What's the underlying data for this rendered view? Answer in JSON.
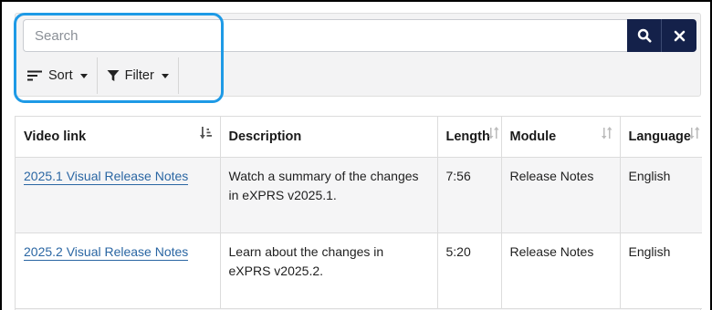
{
  "toolbar": {
    "search_placeholder": "Search",
    "search_value": "",
    "sort_label": "Sort",
    "filter_label": "Filter",
    "search_icon": "search-icon",
    "clear_icon": "close-icon",
    "highlight_color": "#1e9ae6",
    "button_color": "#14214a"
  },
  "table": {
    "columns": [
      {
        "label": "Video link",
        "sort_icon": "sort-amount-down-icon"
      },
      {
        "label": "Description",
        "sort_icon": ""
      },
      {
        "label": "Length",
        "sort_icon": "sort-icon"
      },
      {
        "label": "Module",
        "sort_icon": "sort-icon"
      },
      {
        "label": "Language",
        "sort_icon": "sort-icon"
      }
    ],
    "rows": [
      {
        "video_link": "2025.1 Visual Release Notes",
        "description": "Watch a summary of the changes in eXPRS v2025.1.",
        "length": "7:56",
        "module": "Release Notes",
        "language": "English"
      },
      {
        "video_link": "2025.2 Visual Release Notes",
        "description": "Learn about the changes in eXPRS v2025.2.",
        "length": "5:20",
        "module": "Release Notes",
        "language": "English"
      }
    ],
    "link_color": "#2a66a3"
  }
}
